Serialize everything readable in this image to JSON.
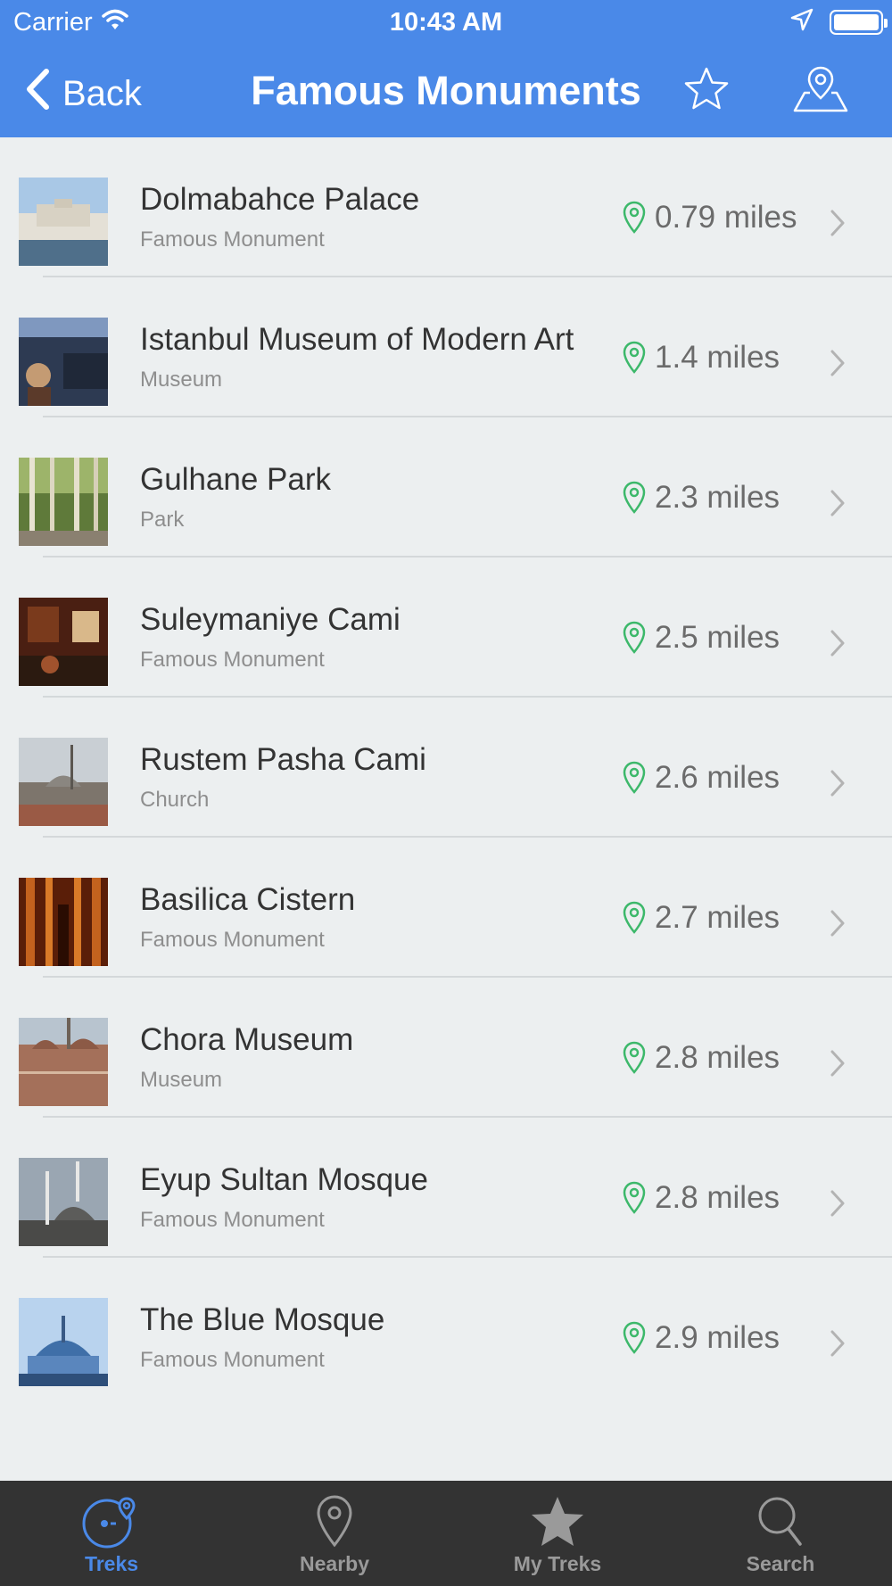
{
  "status_bar": {
    "carrier": "Carrier",
    "time": "10:43 AM"
  },
  "nav": {
    "back_label": "Back",
    "title": "Famous Monuments"
  },
  "items": [
    {
      "name": "Dolmabahce Palace",
      "category": "Famous Monument",
      "distance": "0.79 miles"
    },
    {
      "name": "Istanbul Museum of Modern Art",
      "category": "Museum",
      "distance": "1.4 miles"
    },
    {
      "name": "Gulhane Park",
      "category": "Park",
      "distance": "2.3 miles"
    },
    {
      "name": "Suleymaniye Cami",
      "category": "Famous Monument",
      "distance": "2.5 miles"
    },
    {
      "name": "Rustem Pasha Cami",
      "category": "Church",
      "distance": "2.6 miles"
    },
    {
      "name": "Basilica Cistern",
      "category": "Famous Monument",
      "distance": "2.7 miles"
    },
    {
      "name": "Chora Museum",
      "category": "Museum",
      "distance": "2.8 miles"
    },
    {
      "name": "Eyup Sultan Mosque",
      "category": "Famous Monument",
      "distance": "2.8 miles"
    },
    {
      "name": "The Blue Mosque",
      "category": "Famous Monument",
      "distance": "2.9 miles"
    }
  ],
  "tabs": [
    {
      "label": "Treks",
      "icon": "treks-icon",
      "active": true
    },
    {
      "label": "Nearby",
      "icon": "location-pin-icon",
      "active": false
    },
    {
      "label": "My Treks",
      "icon": "star-icon",
      "active": false
    },
    {
      "label": "Search",
      "icon": "search-icon",
      "active": false
    }
  ],
  "colors": {
    "accent": "#4a89e8",
    "pin": "#3cb86a",
    "tabbar": "#333333",
    "background": "#eceff0"
  }
}
